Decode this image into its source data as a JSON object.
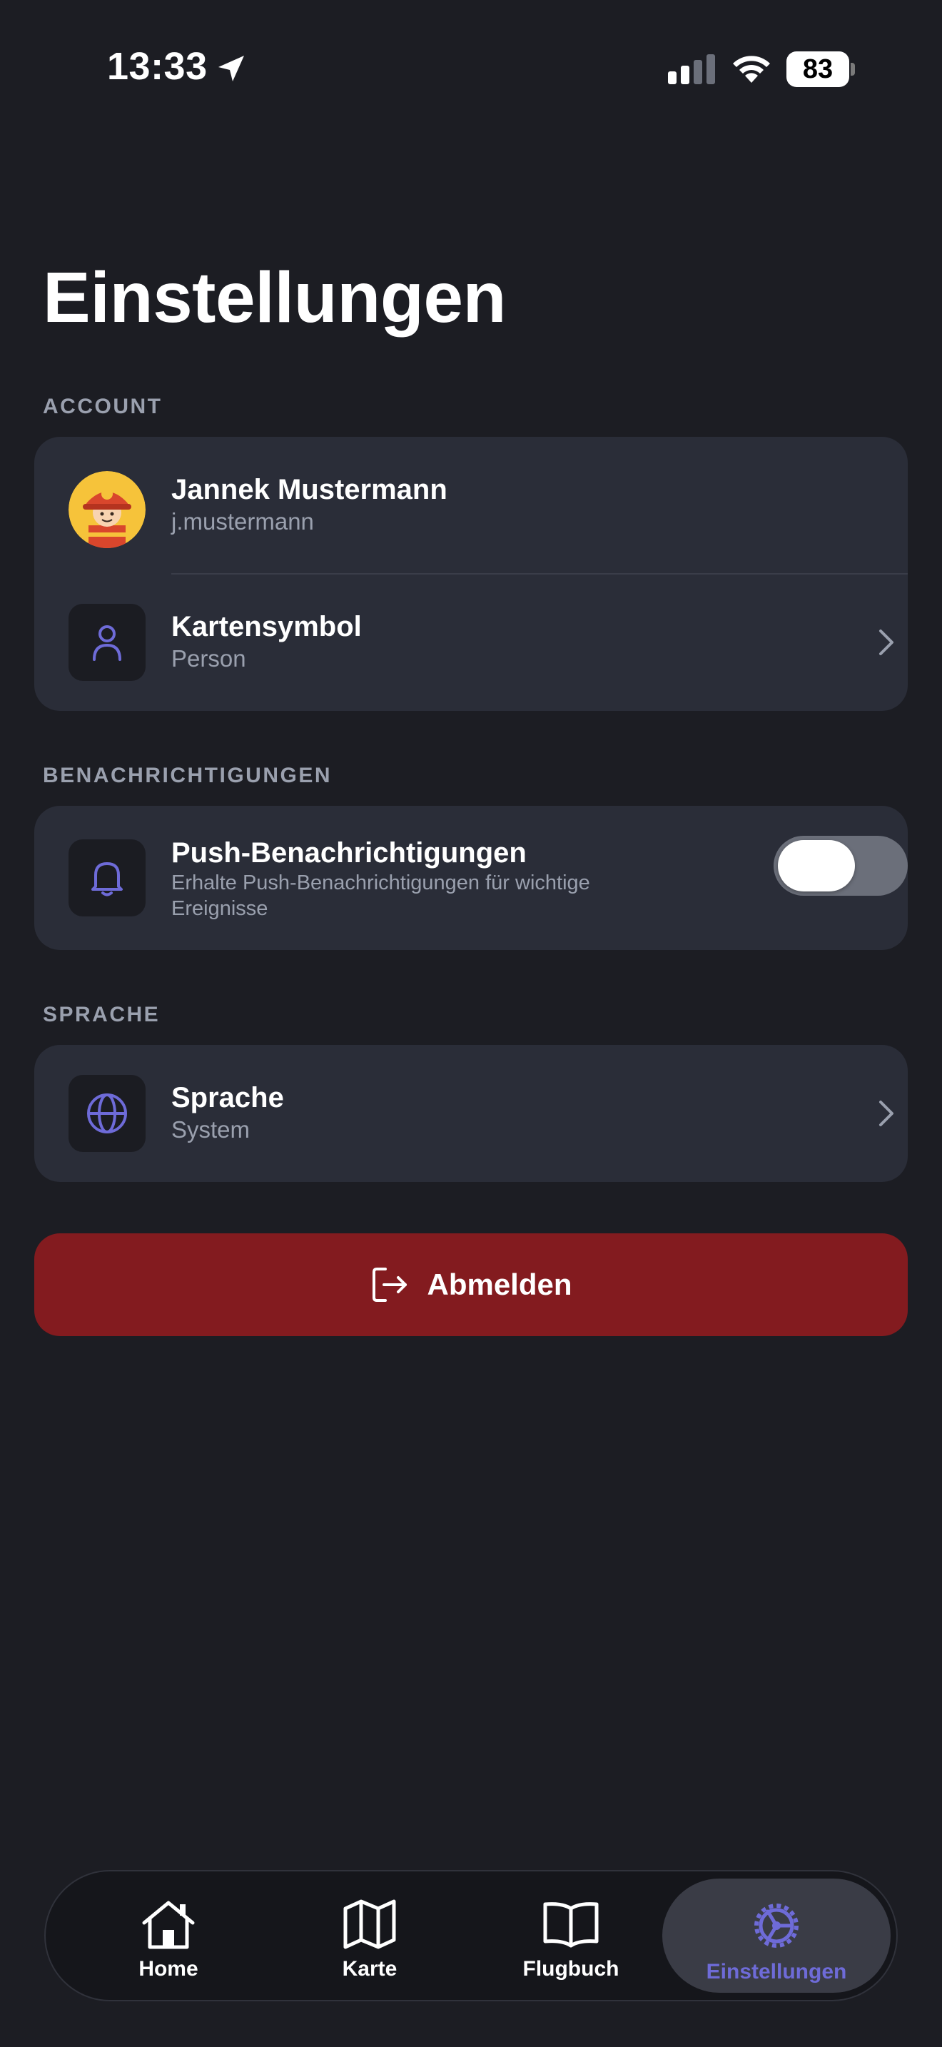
{
  "status_bar": {
    "time": "13:33",
    "battery": "83"
  },
  "page": {
    "title": "Einstellungen"
  },
  "sections": {
    "account": {
      "label": "ACCOUNT",
      "user": {
        "name": "Jannek Mustermann",
        "username": "j.mustermann"
      },
      "map_symbol": {
        "title": "Kartensymbol",
        "value": "Person"
      }
    },
    "notifications": {
      "label": "BENACHRICHTIGUNGEN",
      "push": {
        "title": "Push-Benachrichtigungen",
        "description_line1": "Erhalte Push-Benachrichtigungen für wichtige",
        "description_line2": "Ereignisse",
        "enabled": false
      }
    },
    "language": {
      "label": "SPRACHE",
      "setting": {
        "title": "Sprache",
        "value": "System"
      }
    }
  },
  "logout": {
    "label": "Abmelden"
  },
  "tabbar": {
    "tabs": [
      {
        "label": "Home",
        "icon": "house-icon"
      },
      {
        "label": "Karte",
        "icon": "map-icon"
      },
      {
        "label": "Flugbuch",
        "icon": "book-icon"
      },
      {
        "label": "Einstellungen",
        "icon": "gear-icon",
        "active": true
      }
    ]
  },
  "colors": {
    "background": "#1c1d23",
    "card": "#2a2d38",
    "accent": "#6e6bd8",
    "logout": "#831b1f",
    "muted_text": "#9aa0ae"
  }
}
